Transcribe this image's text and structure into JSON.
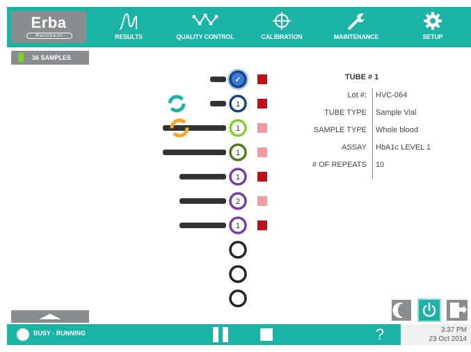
{
  "logo": {
    "text": "Erba",
    "subtext": "Mannheim"
  },
  "nav": [
    {
      "label": "RESULTS",
      "icon": "results-icon"
    },
    {
      "label": "QUALITY CONTROL",
      "icon": "quality-control-icon"
    },
    {
      "label": "CALIBRATION",
      "icon": "calibration-icon"
    },
    {
      "label": "MAINTENANCE",
      "icon": "wrench-icon"
    },
    {
      "label": "SETUP",
      "icon": "gear-icon"
    }
  ],
  "samples": {
    "label": "36 SAMPLES"
  },
  "carousel": {
    "slots": [
      {
        "number": "✓",
        "ring_color": "#1a3f8a",
        "fill": "#3a7bd5",
        "checked": true,
        "tube_length": "short",
        "status_color": "#c0101a"
      },
      {
        "number": "1",
        "ring_color": "#1a3f8a",
        "fill": "#ffffff",
        "checked": false,
        "tube_length": "short",
        "status_color": "#c0101a"
      },
      {
        "number": "1",
        "ring_color": "#7ed321",
        "fill": "#ffffff",
        "checked": false,
        "tube_length": "long",
        "status_color": "#f29a9f"
      },
      {
        "number": "1",
        "ring_color": "#4f7a1a",
        "fill": "#ffffff",
        "checked": false,
        "tube_length": "long",
        "status_color": "#f29a9f"
      },
      {
        "number": "1",
        "ring_color": "#7a3aa8",
        "fill": "#ffffff",
        "checked": false,
        "tube_length": "medium",
        "status_color": "#c0101a"
      },
      {
        "number": "2",
        "ring_color": "#7a3aa8",
        "fill": "#ffffff",
        "checked": false,
        "tube_length": "medium",
        "status_color": "#f29a9f"
      },
      {
        "number": "1",
        "ring_color": "#7a3aa8",
        "fill": "#ffffff",
        "checked": false,
        "tube_length": "medium",
        "status_color": "#c0101a"
      },
      {
        "number": "",
        "ring_color": "#222222",
        "fill": "#ffffff",
        "checked": false,
        "tube_length": "none",
        "status_color": ""
      },
      {
        "number": "",
        "ring_color": "#222222",
        "fill": "#ffffff",
        "checked": false,
        "tube_length": "none",
        "status_color": ""
      },
      {
        "number": "",
        "ring_color": "#222222",
        "fill": "#ffffff",
        "checked": false,
        "tube_length": "none",
        "status_color": ""
      }
    ],
    "spinners": [
      {
        "name": "teal-spinner-icon",
        "color": "#1bb3a5"
      },
      {
        "name": "orange-spinner-icon",
        "color": "#f5a623"
      }
    ]
  },
  "tube_info": {
    "title": "TUBE # 1",
    "rows": [
      {
        "label": "Lot #:",
        "value": "HVC-064"
      },
      {
        "label": "TUBE TYPE",
        "value": "Sample Vial"
      },
      {
        "label": "SAMPLE TYPE",
        "value": "Whole blood"
      },
      {
        "label": "ASSAY",
        "value": "HbA1c LEVEL 1"
      },
      {
        "label": "# OF REPEATS",
        "value": "10"
      }
    ]
  },
  "status": {
    "text": "BUSY - RUNNING"
  },
  "help": {
    "label": "?"
  },
  "datetime": {
    "time": "3:37 PM",
    "date": "23 Oct 2014"
  },
  "colors": {
    "accent": "#1bb3a5",
    "gray": "#8a8d8f",
    "error_red": "#c0101a",
    "warn_pink": "#f29a9f"
  }
}
